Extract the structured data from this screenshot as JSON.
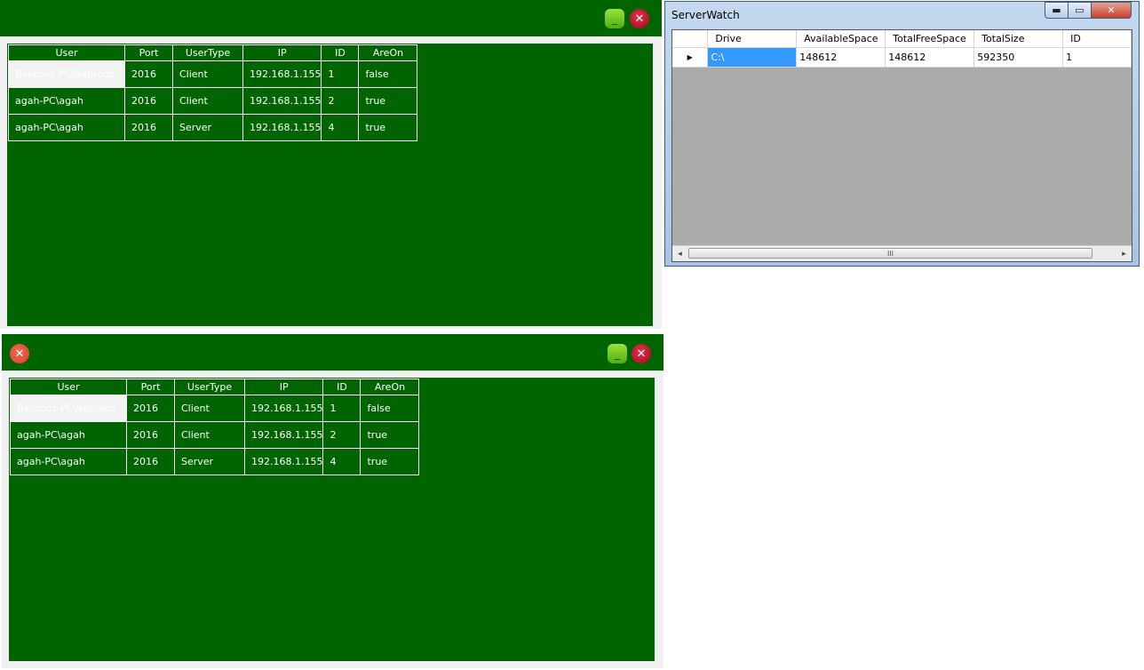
{
  "green_window_top": {
    "buttons": {
      "minimize": "_",
      "close": "✕"
    },
    "columns": [
      "User",
      "Port",
      "UserType",
      "IP",
      "ID",
      "AreOn"
    ],
    "rows": [
      [
        "Behrooz-PC\\Behrooz",
        "2016",
        "Client",
        "192.168.1.155",
        "1",
        "false"
      ],
      [
        "agah-PC\\agah",
        "2016",
        "Client",
        "192.168.1.155",
        "2",
        "true"
      ],
      [
        "agah-PC\\agah",
        "2016",
        "Server",
        "192.168.1.155",
        "4",
        "true"
      ]
    ]
  },
  "green_window_bottom": {
    "buttons": {
      "left_close": "✕",
      "minimize": "_",
      "close": "✕"
    },
    "columns": [
      "User",
      "Port",
      "UserType",
      "IP",
      "ID",
      "AreOn"
    ],
    "rows": [
      [
        "Behrooz-PC\\Behrooz",
        "2016",
        "Client",
        "192.168.1.155",
        "1",
        "false"
      ],
      [
        "agah-PC\\agah",
        "2016",
        "Client",
        "192.168.1.155",
        "2",
        "true"
      ],
      [
        "agah-PC\\agah",
        "2016",
        "Server",
        "192.168.1.155",
        "4",
        "true"
      ]
    ]
  },
  "server_watch": {
    "title": "ServerWatch",
    "caption_buttons": {
      "minimize": "▬",
      "maximize": "▭",
      "close": "✕"
    },
    "columns": [
      "Drive",
      "AvailableSpace",
      "TotalFreeSpace",
      "TotalSize",
      "ID"
    ],
    "rows": [
      {
        "indicator": "▶",
        "cells": [
          "C:\\",
          "148612",
          "148612",
          "592350",
          "1"
        ]
      }
    ],
    "scrollbar": {
      "left": "◂",
      "right": "▸",
      "grip": "III"
    }
  },
  "colors": {
    "green_panel": "#006400",
    "selection_blue": "#3399ff",
    "grid_empty": "#ababab"
  }
}
